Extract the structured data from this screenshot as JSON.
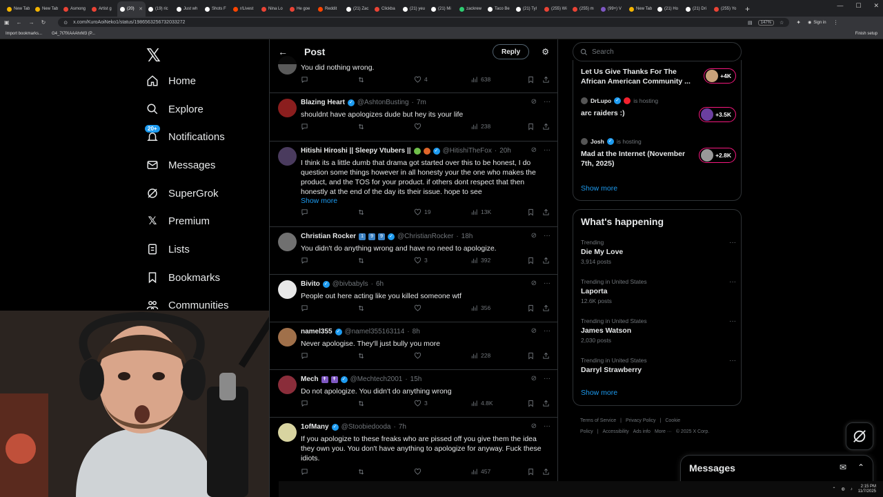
{
  "browser": {
    "tabs": [
      {
        "label": "New Tab",
        "color": "#f4b400"
      },
      {
        "label": "New Tab",
        "color": "#f4b400"
      },
      {
        "label": "Asmong",
        "color": "#ea4335"
      },
      {
        "label": "Artist g",
        "color": "#ea4335"
      },
      {
        "label": "(20)",
        "color": "#ffffff",
        "active": true
      },
      {
        "label": "(19) ric",
        "color": "#ffffff"
      },
      {
        "label": "Just wh",
        "color": "#ffffff"
      },
      {
        "label": "Shots F",
        "color": "#ffffff"
      },
      {
        "label": "r/Livest",
        "color": "#ff4500"
      },
      {
        "label": "Nina Lo",
        "color": "#ea4335"
      },
      {
        "label": "He goe",
        "color": "#ea4335"
      },
      {
        "label": "Reddit",
        "color": "#ff4500"
      },
      {
        "label": "(21) Zac",
        "color": "#ffffff"
      },
      {
        "label": "Clickba",
        "color": "#ea4335"
      },
      {
        "label": "(21) yeu",
        "color": "#ffffff"
      },
      {
        "label": "(21) Mi",
        "color": "#ffffff"
      },
      {
        "label": "zackrew",
        "color": "#2ecc71"
      },
      {
        "label": "Taco Be",
        "color": "#ffffff"
      },
      {
        "label": "(21) Tyl",
        "color": "#ffffff"
      },
      {
        "label": "(255) Wi",
        "color": "#ea4335"
      },
      {
        "label": "(255) m",
        "color": "#ea4335"
      },
      {
        "label": "(99+) V",
        "color": "#7e57c2"
      },
      {
        "label": "New Tab",
        "color": "#f4b400"
      },
      {
        "label": "(21) Ho",
        "color": "#ffffff"
      },
      {
        "label": "(21) Dri",
        "color": "#ffffff"
      },
      {
        "label": "(255) Yo",
        "color": "#ea4335"
      }
    ],
    "url": "x.com/KuroAoiNeko1/status/1986563256732033272",
    "zoom": "147%",
    "signin_label": "Sign in",
    "bookmarks": [
      "Import bookmarks...",
      "G4_7t7fXAAAhrM3 (P..."
    ],
    "finish_setup": "Finish setup"
  },
  "nav": {
    "items": [
      "Home",
      "Explore",
      "Notifications",
      "Messages",
      "SuperGrok",
      "Premium",
      "Lists",
      "Bookmarks",
      "Communities"
    ],
    "notif_badge": "20+"
  },
  "header": {
    "title": "Post",
    "reply_label": "Reply"
  },
  "tweets": [
    {
      "name": "",
      "handle": "",
      "time": "",
      "text": "You did nothing wrong.",
      "replies": "",
      "retweets": "",
      "likes": "4",
      "views": "638",
      "avatar": "#5a5a5a"
    },
    {
      "name": "Blazing Heart",
      "handle": "@AshtonBusting",
      "time": "7m",
      "text": "shouldnt have apologizes dude but hey its your life",
      "likes": "",
      "views": "238",
      "avatar": "#8b1e1e"
    },
    {
      "name": "Hitishi Hiroshi || Sleepy Vtubers ||",
      "handle": "@HitishiTheFox",
      "time": "20h",
      "text": "I think its a little dumb that drama got started over this to be honest, I do question some things however in all honesty your the one who makes the product, and the TOS for your product. if others dont respect that then honestly at the end of the day its their issue. hope to see",
      "show_more": "Show more",
      "likes": "19",
      "views": "13K",
      "avatar": "#4a3b5e"
    },
    {
      "name": "Christian Rocker",
      "badges": [
        "1",
        "9",
        "9"
      ],
      "handle": "@ChristianRocker",
      "time": "18h",
      "text": "You didn't do anything wrong and have no need to apologize.",
      "likes": "3",
      "views": "392",
      "avatar": "#707070"
    },
    {
      "name": "Bivito",
      "handle": "@bivbabyls",
      "time": "6h",
      "text": "People out here acting like you killed someone wtf",
      "likes": "",
      "views": "356",
      "avatar": "#e8e8e8"
    },
    {
      "name": "namel355",
      "handle": "@namel355163114",
      "time": "8h",
      "text": "Never apologise. They'll just bully you more",
      "likes": "",
      "views": "228",
      "avatar": "#a0704a"
    },
    {
      "name": "Mech",
      "badges": [
        "✝",
        "✝"
      ],
      "handle": "@Mechtech2001",
      "time": "15h",
      "text": "Do not apologize. You didn't do anything wrong",
      "likes": "3",
      "views": "4.8K",
      "avatar": "#8a2d3a"
    },
    {
      "name": "1ofMany",
      "handle": "@Stoobiedooda",
      "time": "7h",
      "text": "If you apologize to these freaks who are pissed off you give them the idea they own you. You don't have anything to apologize for anyway. Fuck these idiots.",
      "likes": "",
      "views": "457",
      "avatar": "#d8d4a0"
    }
  ],
  "sidebar": {
    "search_placeholder": "Search",
    "live": [
      {
        "host": "",
        "hosting": "",
        "title": "Let Us Give Thanks For The African American Community ...",
        "count": "+4K"
      },
      {
        "host": "DrLupo",
        "hosting": "is hosting",
        "title": "arc raiders :)",
        "count": "+3.5K"
      },
      {
        "host": "Josh",
        "hosting": "is hosting",
        "title": "Mad at the Internet (November 7th, 2025)",
        "count": "+2.8K"
      }
    ],
    "show_more": "Show more",
    "whats_happening": "What's happening",
    "trends": [
      {
        "context": "Trending",
        "title": "Die My Love",
        "count": "3,914 posts"
      },
      {
        "context": "Trending in United States",
        "title": "Laporta",
        "count": "12.6K posts"
      },
      {
        "context": "Trending in United States",
        "title": "James Watson",
        "count": "2,030 posts"
      },
      {
        "context": "Trending in United States",
        "title": "Darryl Strawberry",
        "count": ""
      }
    ],
    "show_more_2": "Show more",
    "footer": [
      "Terms of Service",
      "|",
      "Privacy Policy",
      "|",
      "Cookie Policy",
      "|",
      "Accessibility",
      "Ads info",
      "More ···",
      "© 2025 X Corp."
    ]
  },
  "messages_drawer": {
    "title": "Messages"
  },
  "taskbar": {
    "time": "2:15 PM",
    "date": "11/7/2025"
  }
}
